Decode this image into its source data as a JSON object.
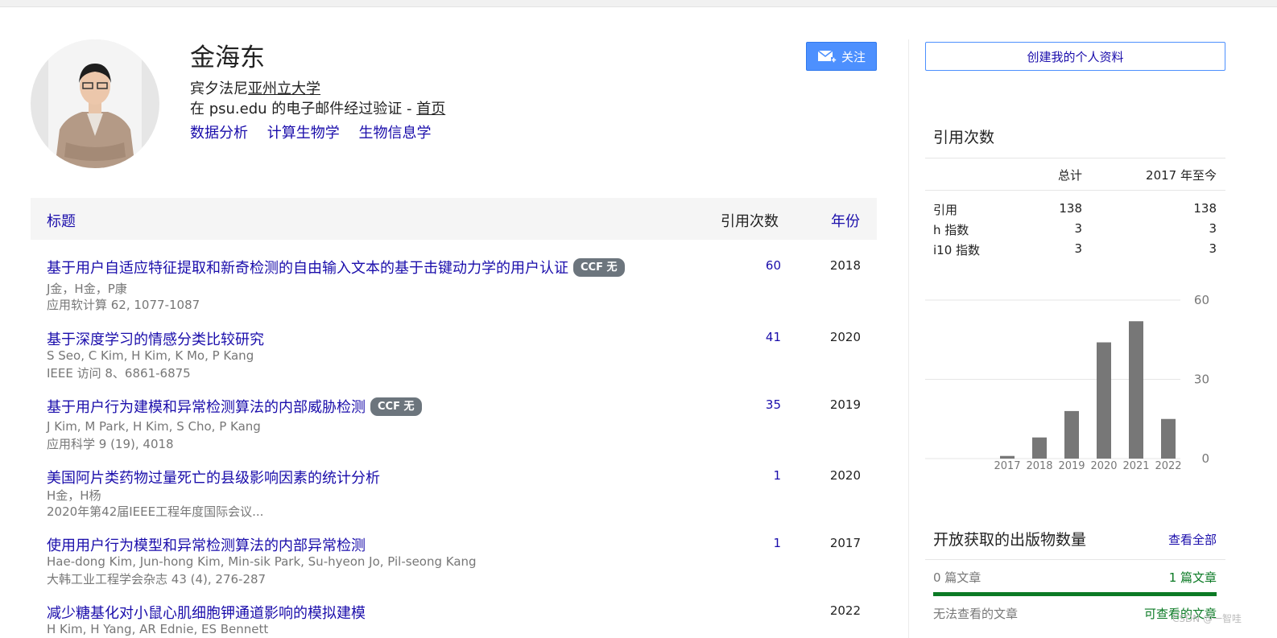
{
  "profile": {
    "name": "金海东",
    "affiliation_prefix": "宾夕法尼",
    "affiliation_link": "亚州立大学",
    "email_text": "在 psu.edu 的电子邮件经过验证 - ",
    "homepage": "首页",
    "interests": [
      "数据分析",
      "计算生物学",
      "生物信息学"
    ],
    "follow_label": "关注",
    "create_label": "创建我的个人资料"
  },
  "table": {
    "col_title": "标题",
    "col_cites": "引用次数",
    "col_year": "年份",
    "rows": [
      {
        "title": "基于用户自适应特征提取和新奇检测的自由输入文本的基于击键动力学的用户认证",
        "badge": "CCF 无",
        "authors": "J金，H金，P康",
        "venue": "应用软计算 62, 1077-1087",
        "cites": "60",
        "year": "2018"
      },
      {
        "title": "基于深度学习的情感分类比较研究",
        "badge": "",
        "authors": "S Seo, C Kim, H Kim, K Mo, P Kang",
        "venue": "IEEE 访问 8、6861-6875",
        "cites": "41",
        "year": "2020"
      },
      {
        "title": "基于用户行为建模和异常检测算法的内部威胁检测",
        "badge": "CCF 无",
        "authors": "J Kim, M Park, H Kim, S Cho, P Kang",
        "venue": "应用科学 9 (19), 4018",
        "cites": "35",
        "year": "2019"
      },
      {
        "title": "美国阿片类药物过量死亡的县级影响因素的统计分析",
        "badge": "",
        "authors": "H金，H杨",
        "venue": "2020年第42届IEEE工程年度国际会议...",
        "cites": "1",
        "year": "2020"
      },
      {
        "title": "使用用户行为模型和异常检测算法的内部异常检测",
        "badge": "",
        "authors": "Hae-dong Kim, Jun-hong Kim, Min-sik Park, Su-hyeon Jo, Pil-seong Kang",
        "venue": "大韩工业工程学会杂志 43 (4), 276-287",
        "cites": "1",
        "year": "2017"
      },
      {
        "title": "减少糖基化对小鼠心肌细胞钾通道影响的模拟建模",
        "badge": "",
        "authors": "H Kim, H Yang, AR Ednie, ES Bennett",
        "venue": "",
        "cites": "",
        "year": "2022"
      }
    ]
  },
  "citations": {
    "heading": "引用次数",
    "col_total": "总计",
    "col_since": "2017 年至今",
    "rows": [
      {
        "label": "引用",
        "total": "138",
        "since": "138"
      },
      {
        "label": "h 指数",
        "total": "3",
        "since": "3"
      },
      {
        "label": "i10 指数",
        "total": "3",
        "since": "3"
      }
    ]
  },
  "chart_data": {
    "type": "bar",
    "categories": [
      "2017",
      "2018",
      "2019",
      "2020",
      "2021",
      "2022"
    ],
    "values": [
      1,
      8,
      18,
      44,
      52,
      15
    ],
    "ylim": [
      0,
      60
    ],
    "yticks": [
      "0",
      "30",
      "60"
    ],
    "grid": true,
    "bar_color": "#777777"
  },
  "open_access": {
    "heading": "开放获取的出版物数量",
    "view_all": "查看全部",
    "left1": "0 篇文章",
    "right1": "1 篇文章",
    "left2": "无法查看的文章",
    "right2": "可查看的文章"
  },
  "watermark": "CSDN @一智哇",
  "colors": {
    "link": "#1a0dab",
    "accent": "#4d90fe",
    "green": "#0b7a25"
  }
}
